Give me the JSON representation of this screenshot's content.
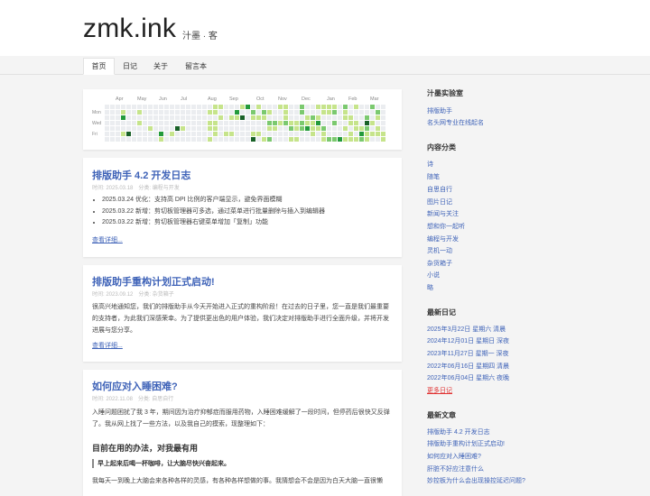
{
  "site": {
    "title": "zmk.ink",
    "subtitle": "汁墨 · 客"
  },
  "nav": {
    "tabs": [
      "首页",
      "日记",
      "关于",
      "留言本"
    ],
    "active": 0
  },
  "heatmap": {
    "months": [
      "Apr",
      "May",
      "Jun",
      "Jul",
      "Aug",
      "Sep",
      "Oct",
      "Nov",
      "Dec",
      "Jan",
      "Feb",
      "Mar"
    ],
    "days": [
      "Mon",
      "Wed",
      "Fri"
    ],
    "colors": [
      "#ebedf0",
      "#c6e48b",
      "#7bc96f",
      "#239a3b",
      "#196127"
    ]
  },
  "posts": [
    {
      "title": "排版助手 4.2 开发日志",
      "date": "时间: 2025.03.18",
      "category": "分类: 编程与开发",
      "items": [
        "2025.03.24 优化：支持高 DPI 比例的客户端显示，避免界面模糊",
        "2025.03.22 新增：剪切板管理器可多选，通过菜单进行批量删除与插入到编辑器",
        "2025.03.22 新增：剪切板管理器右键菜单增加「复制」功能"
      ],
      "more": "查看详细..."
    },
    {
      "title": "排版助手重构计划正式启动!",
      "date": "时间: 2023.09.12",
      "category": "分类: 杂货箱子",
      "text": "很高兴地通知您，我们的排版助手从今天开始进入正式的重构阶段！在过去的日子里，您一直是我们最重要的支持者，为此我们深感荣幸。为了提供更出色的用户体验，我们决定对排版助手进行全面升级，并将开发进展与您分享。",
      "more": "查看详细..."
    },
    {
      "title": "如何应对入睡困难?",
      "date": "时间: 2022.11.08",
      "category": "分类: 自思自行",
      "text": "入睡问题困扰了我 3 年，期间因为治疗抑郁症而服用药物，入睡困难缓解了一段时间，但停药后很快又反弹了。我从网上找了一些方法，以及我自己的摸索，现整理如下：",
      "heading": "目前在用的办法，对我最有用",
      "quote": "早上起来后喝一杯咖啡，让大脑尽快兴奋起来。",
      "text2": "我每天一到晚上大脑会来各种各样的灵感，有各种各样想做的事。我猜想会不会是因为白天大脑一直很懒"
    }
  ],
  "sidebar": {
    "sections": [
      {
        "title": "汁墨实验室",
        "links": [
          "排版助手",
          "名头网专业在线起名"
        ]
      },
      {
        "title": "内容分类",
        "links": [
          "诗",
          "随笔",
          "自思自行",
          "图片日记",
          "新闻与关注",
          "想和你一起听",
          "编程与开发",
          "灵机一动",
          "杂货箱子",
          "小说",
          "略"
        ]
      },
      {
        "title": "最新日记",
        "links": [
          "2025年3月22日 星期六 清晨",
          "2024年12月01日 星期日 深夜",
          "2023年11月27日 星期一 深夜",
          "2022年06月16日 星期四 清晨",
          "2022年06月04日 星期六 夜晚",
          "更多日记"
        ]
      },
      {
        "title": "最新文章",
        "links": [
          "排版助手 4.2 开发日志",
          "排版助手重构计划正式启动!",
          "如何应对入睡困难?",
          "肝脏不好应注意什么",
          "妙控板为什么会出现操控延迟问题?"
        ]
      }
    ]
  }
}
